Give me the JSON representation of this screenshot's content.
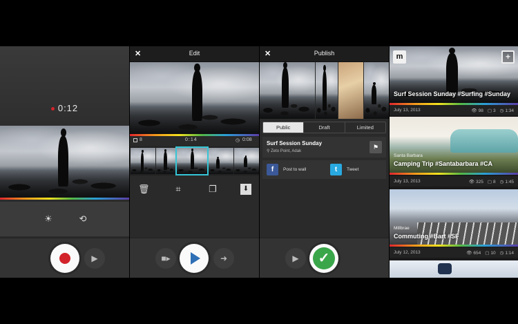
{
  "recorder": {
    "timer": "0:12",
    "tools": {
      "exposure_icon": "sun-icon",
      "flip_icon": "camera-flip-icon"
    },
    "record_icon": "record-icon",
    "next_icon": "play-icon"
  },
  "edit": {
    "title": "Edit",
    "clip_count": "8",
    "current_time": "0:14",
    "clip_duration": "0:08",
    "tools": [
      "trash-icon",
      "crop-icon",
      "duplicate-icon",
      "save-icon"
    ]
  },
  "publish": {
    "title": "Publish",
    "privacy_tabs": [
      "Public",
      "Draft",
      "Limited"
    ],
    "post_title": "Surf Session Sunday",
    "location": "Zeto Point, Adak",
    "share": [
      {
        "icon": "facebook-icon",
        "glyph": "f",
        "label": "Post to wall",
        "color": "#3b5998"
      },
      {
        "icon": "twitter-icon",
        "glyph": "t",
        "label": "Tweet",
        "color": "#29a9e1"
      }
    ]
  },
  "feed": {
    "logo_glyph": "m",
    "items": [
      {
        "location": "",
        "title": "Surf Session Sunday #Surfing #Sunday",
        "date": "July 13, 2013",
        "views": "98",
        "clips": "3",
        "duration": "1:34"
      },
      {
        "location": "Santa Barbara",
        "title": "Camping Trip #Santabarbara #CA",
        "date": "July 13, 2013",
        "views": "325",
        "clips": "8",
        "duration": "1:45"
      },
      {
        "location": "Millbrae",
        "title": "Commuting #Bart #SF",
        "date": "July 12, 2013",
        "views": "654",
        "clips": "10",
        "duration": "1:14"
      }
    ]
  },
  "colors": {
    "accent_cyan": "#35c6d6",
    "record_red": "#d2232a",
    "confirm_green": "#3aa64a",
    "play_blue": "#2f6fb5"
  }
}
